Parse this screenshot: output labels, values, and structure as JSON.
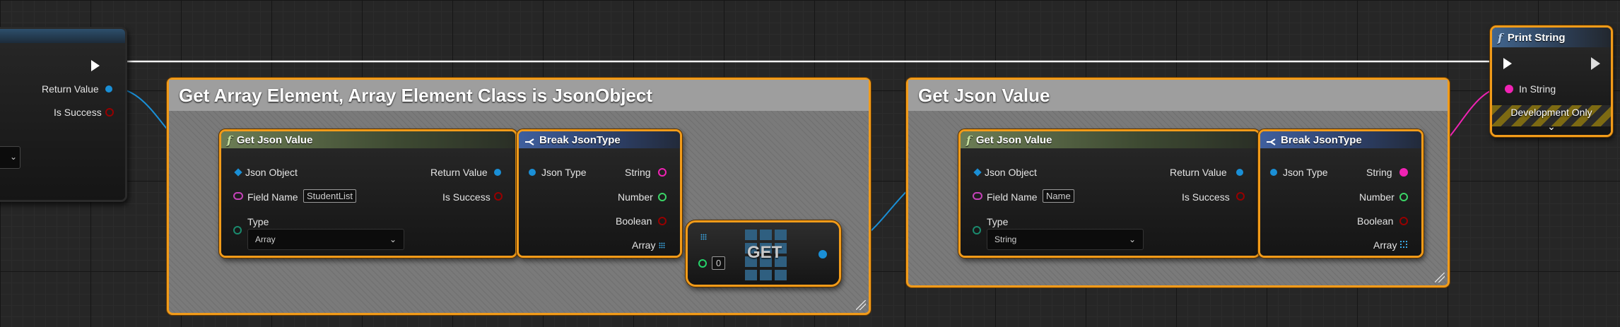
{
  "colors": {
    "selection": "#f19b1a",
    "object_pin": "#1a8fd6",
    "name_pin": "#c542b9",
    "string_pin": "#f023b4",
    "number_pin": "#3bd466",
    "int_pin": "#25d36a",
    "bool_pin": "#970000",
    "type_pin": "#1a8a6d"
  },
  "left_node": {
    "return_value": "Return Value",
    "is_success": "Is Success",
    "collapse_icon": "chevron-down-icon"
  },
  "comment1": {
    "title": "Get Array Element, Array Element Class is JsonObject"
  },
  "comment2": {
    "title": "Get Json Value"
  },
  "gjv1": {
    "icon": "function-icon",
    "title": "Get Json Value",
    "json_object": "Json Object",
    "field_name": "Field Name",
    "field_value": "StudentList",
    "type": "Type",
    "type_value": "Array",
    "return_value": "Return Value",
    "is_success": "Is Success"
  },
  "brk1": {
    "icon": "break-struct-icon",
    "title": "Break JsonType",
    "json_type": "Json Type",
    "string": "String",
    "number": "Number",
    "boolean": "Boolean",
    "array": "Array"
  },
  "get": {
    "label": "GET",
    "index": "0",
    "icon": "array-grid-icon"
  },
  "gjv2": {
    "icon": "function-icon",
    "title": "Get Json Value",
    "json_object": "Json Object",
    "field_name": "Field Name",
    "field_value": "Name",
    "type": "Type",
    "type_value": "String",
    "return_value": "Return Value",
    "is_success": "Is Success"
  },
  "brk2": {
    "icon": "break-struct-icon",
    "title": "Break JsonType",
    "json_type": "Json Type",
    "string": "String",
    "number": "Number",
    "boolean": "Boolean",
    "array": "Array"
  },
  "print": {
    "icon": "function-icon",
    "title": "Print String",
    "in_string": "In String",
    "dev_only": "Development Only",
    "expand_icon": "chevron-down-icon"
  }
}
